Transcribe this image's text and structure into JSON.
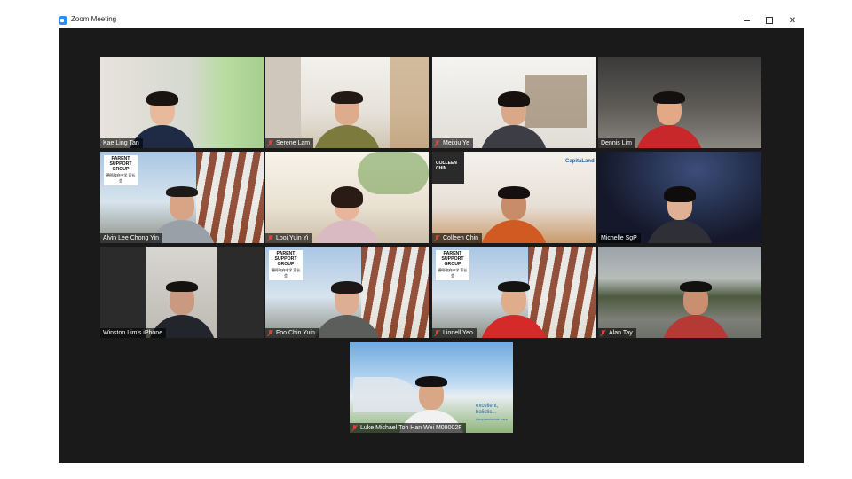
{
  "window": {
    "title": "Zoom Meeting",
    "min_icon": "minimize-icon",
    "max_icon": "restore-icon",
    "close_icon": "close-icon"
  },
  "colors": {
    "active_speaker_border": "#b7e22c",
    "muted_mic": "#e0403a",
    "stage_bg": "#1a1a1a"
  },
  "participants": [
    {
      "name": "Kae Ling Tan",
      "muted": false
    },
    {
      "name": "Serene Lam",
      "muted": true
    },
    {
      "name": "Meixiu Ye",
      "muted": true
    },
    {
      "name": "Dennis Lim",
      "muted": false
    },
    {
      "name": "Alvin Lee Chong Yin",
      "muted": false
    },
    {
      "name": "Looi Yuin Yi",
      "muted": true
    },
    {
      "name": "Colleen Chin",
      "muted": true
    },
    {
      "name": "Michelle SgP",
      "muted": false
    },
    {
      "name": "Winston Lim's iPhone",
      "muted": false
    },
    {
      "name": "Foo Chin Yuin",
      "muted": true,
      "active": true
    },
    {
      "name": "Lionell Yeo",
      "muted": true
    },
    {
      "name": "Alan Tay",
      "muted": true
    },
    {
      "name": "Luke Michael Toh Han Wei M09002F",
      "muted": true
    }
  ],
  "backgrounds": {
    "parent_support_group": {
      "line1": "PARENT",
      "line2": "SUPPORT",
      "line3": "GROUP",
      "chinese": "德明政府中学 家长会"
    },
    "colleen_sign": {
      "line1": "COLLEEN",
      "line2": "CHIN"
    },
    "capitaland": "CapitaLand",
    "hospital_tagline": {
      "line1": "excellent,",
      "line2": "holistic...",
      "line3": "compassionate care"
    }
  }
}
